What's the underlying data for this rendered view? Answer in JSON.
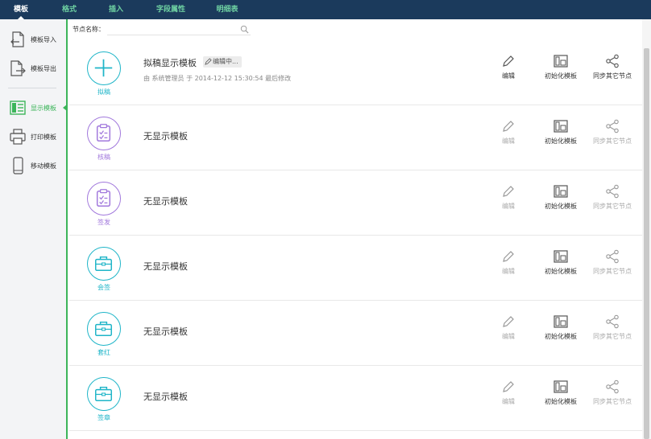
{
  "topbar": {
    "tabs": [
      {
        "label": "模板",
        "active": true
      },
      {
        "label": "格式",
        "active": false
      },
      {
        "label": "插入",
        "active": false
      },
      {
        "label": "字段属性",
        "active": false
      },
      {
        "label": "明细表",
        "active": false
      }
    ]
  },
  "sidebar": {
    "items": [
      {
        "label": "模板导入",
        "icon": "import-icon",
        "active": false
      },
      {
        "label": "模板导出",
        "icon": "export-icon",
        "active": false
      },
      {
        "label": "显示模板",
        "icon": "display-template-icon",
        "active": true
      },
      {
        "label": "打印模板",
        "icon": "printer-icon",
        "active": false
      },
      {
        "label": "移动模板",
        "icon": "mobile-icon",
        "active": false
      }
    ]
  },
  "search": {
    "label": "节点名称：",
    "value": "",
    "placeholder": ""
  },
  "rows": [
    {
      "node": "拟稿",
      "icon": "plus-icon",
      "color": "#1fb5c8",
      "title": "拟稿显示模板",
      "badge": "编辑中...",
      "meta": "由 系统管理员 于 2014-12-12 15:30:54 最后修改",
      "edit_enabled": true
    },
    {
      "node": "核稿",
      "icon": "clipboard-check-icon",
      "color": "#a178dc",
      "title": "无显示模板",
      "edit_enabled": false
    },
    {
      "node": "签发",
      "icon": "clipboard-check-icon",
      "color": "#a178dc",
      "title": "无显示模板",
      "edit_enabled": false
    },
    {
      "node": "会签",
      "icon": "briefcase-icon",
      "color": "#1fb5c8",
      "title": "无显示模板",
      "edit_enabled": false
    },
    {
      "node": "套红",
      "icon": "briefcase-icon",
      "color": "#1fb5c8",
      "title": "无显示模板",
      "edit_enabled": false
    },
    {
      "node": "签章",
      "icon": "briefcase-icon",
      "color": "#1fb5c8",
      "title": "无显示模板",
      "edit_enabled": false
    }
  ],
  "actions": {
    "edit_label": "编辑",
    "init_label": "初始化模板",
    "sync_label": "同步其它节点"
  },
  "colors": {
    "topbar_bg": "#1b3a5c",
    "tab_inactive": "#6fd3a3",
    "accent_green": "#3cb55a",
    "teal": "#1fb5c8",
    "purple": "#a178dc"
  }
}
